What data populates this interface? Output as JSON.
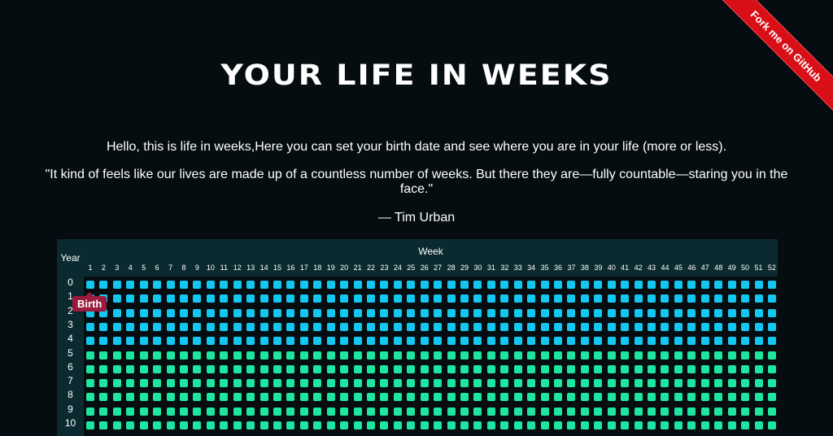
{
  "ribbon": {
    "label": "Fork me on GitHub"
  },
  "header": {
    "title": "YOUR LIFE IN WEEKS"
  },
  "intro": {
    "text": "Hello, this is life in weeks,Here you can set your birth date and see where you are in your life (more or less).",
    "quote": "\"It kind of feels like our lives are made up of a countless number of weeks. But there they are—fully countable—staring you in the face.\"",
    "author": "— Tim Urban"
  },
  "grid": {
    "year_label": "Year",
    "week_label": "Week",
    "weeks": [
      "1",
      "2",
      "3",
      "4",
      "5",
      "6",
      "7",
      "8",
      "9",
      "10",
      "11",
      "12",
      "13",
      "14",
      "15",
      "16",
      "17",
      "18",
      "19",
      "20",
      "21",
      "22",
      "23",
      "24",
      "25",
      "26",
      "27",
      "28",
      "29",
      "30",
      "31",
      "32",
      "33",
      "34",
      "35",
      "36",
      "37",
      "38",
      "39",
      "40",
      "41",
      "42",
      "43",
      "44",
      "45",
      "46",
      "47",
      "48",
      "49",
      "50",
      "51",
      "52"
    ],
    "years": [
      "0",
      "1",
      "2",
      "3",
      "4",
      "5",
      "6",
      "7",
      "8",
      "9",
      "10"
    ],
    "childhood_years": 5,
    "colors": {
      "childhood": "#13c7f0",
      "later": "#1ee6a0"
    },
    "tooltip": "Birth"
  }
}
